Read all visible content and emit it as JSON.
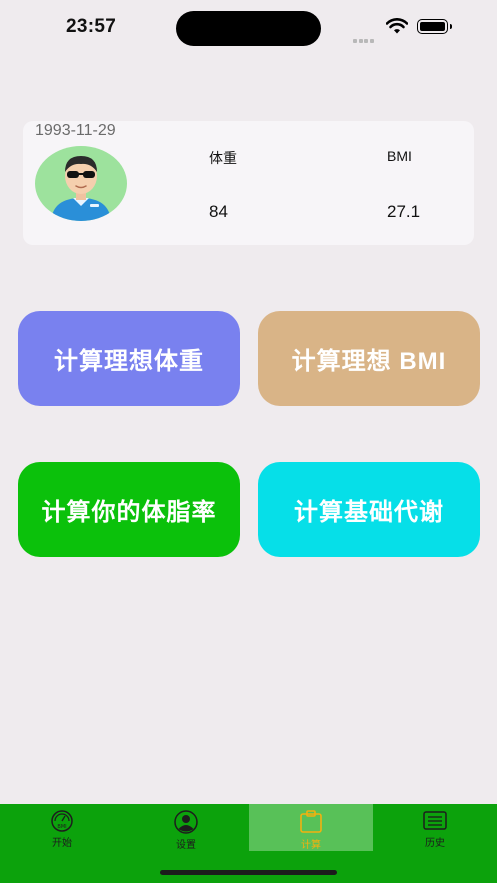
{
  "status_bar": {
    "time": "23:57"
  },
  "profile": {
    "birthdate": "1993-11-29",
    "weight_label": "体重",
    "weight_value": "84",
    "bmi_label": "BMI",
    "bmi_value": "27.1"
  },
  "actions": {
    "ideal_weight": "计算理想体重",
    "ideal_bmi": "计算理想 BMI",
    "body_fat": "计算你的体脂率",
    "bmr": "计算基础代谢"
  },
  "tabs": [
    {
      "label": "开始",
      "icon": "bmi-scale-icon"
    },
    {
      "label": "设置",
      "icon": "user-icon"
    },
    {
      "label": "计算",
      "icon": "clipboard-icon"
    },
    {
      "label": "历史",
      "icon": "list-icon"
    }
  ],
  "active_tab": 2,
  "colors": {
    "background": "#efebee",
    "ideal_weight_button": "#7981ef",
    "ideal_bmi_button": "#d9b487",
    "body_fat_button": "#0bc10b",
    "bmr_button": "#06dfe8",
    "tab_bar": "#0ca20c",
    "active_tab_label": "#f2b10f"
  }
}
